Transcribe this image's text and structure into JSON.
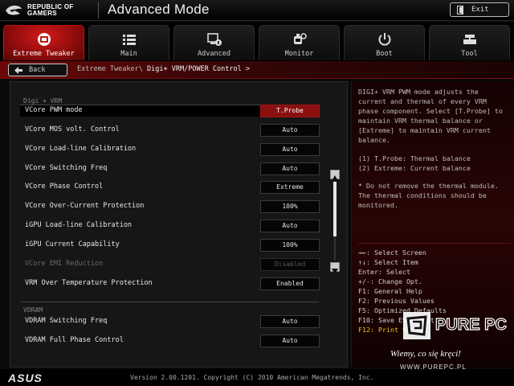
{
  "brand": {
    "line1": "REPUBLIC OF",
    "line2": "GAMERS"
  },
  "title": "Advanced Mode",
  "exit_label": "Exit",
  "tabs": [
    {
      "label": "Extreme Tweaker",
      "icon": "tweaker-icon",
      "active": true
    },
    {
      "label": "Main",
      "icon": "list-icon"
    },
    {
      "label": "Advanced",
      "icon": "advanced-icon"
    },
    {
      "label": "Monitor",
      "icon": "monitor-icon"
    },
    {
      "label": "Boot",
      "icon": "power-icon"
    },
    {
      "label": "Tool",
      "icon": "tool-icon"
    }
  ],
  "back_label": "Back",
  "breadcrumb": {
    "parent": "Extreme Tweaker\\",
    "current": "Digi+ VRM/POWER Control >"
  },
  "groups": {
    "digi": "Digi + VRM",
    "vdram": "VDRAM"
  },
  "settings": [
    {
      "label": "VCore PWM mode",
      "value": "T.Probe"
    },
    {
      "label": "VCore MOS volt. Control",
      "value": "Auto"
    },
    {
      "label": "VCore Load-line Calibration",
      "value": "Auto"
    },
    {
      "label": "VCore Switching Freq",
      "value": "Auto"
    },
    {
      "label": "VCore Phase Control",
      "value": "Extreme"
    },
    {
      "label": "VCore Over-Current Protection",
      "value": "100%"
    },
    {
      "label": "iGPU Load-line Calibration",
      "value": "Auto"
    },
    {
      "label": "iGPU Current Capability",
      "value": "100%"
    },
    {
      "label": "VCore EMI Reduction",
      "value": "Disabled"
    },
    {
      "label": "VRM Over Temperature Protection",
      "value": "Enabled"
    },
    {
      "label": "VDRAM Switching Freq",
      "value": "Auto"
    },
    {
      "label": "VDRAM Full Phase Control",
      "value": "Auto"
    }
  ],
  "help": {
    "l1": "DIGI+ VRM PWM mode adjusts the",
    "l2": "current and thermal of every VRM",
    "l3": "phase component. Select [T.Probe] to",
    "l4": "maintain VRM thermal balance or",
    "l5": "[Extreme] to maintain VRM current",
    "l6": "balance.",
    "o1": "(1) T.Probe: Thermal balance",
    "o2": "(2) Extreme: Current balance",
    "n1": "* Do not remove the thermal module.",
    "n2": "The thermal conditions should be",
    "n3": "monitored."
  },
  "keys": {
    "k1": "→←: Select Screen",
    "k2": "↑↓: Select Item",
    "k3": "Enter: Select",
    "k4": "+/-: Change Opt.",
    "k5": "F1: General Help",
    "k6": "F2: Previous Values",
    "k7": "F5: Optimized Defaults",
    "k8": "F10: Save ESC: Exit",
    "k9": "F12: Print Screen"
  },
  "watermark": {
    "brand": "PURE PC",
    "tagline": "Wiemy, co się kręci!",
    "url": "WWW.PUREPC.PL"
  },
  "footer": {
    "logo": "ASUS",
    "version": "Version 2.00.1201. Copyright (C) 2010 American Megatrends, Inc."
  },
  "colors": {
    "accent": "#c01515",
    "selected": "#8a1010",
    "hotkey": "#f0c41a"
  }
}
